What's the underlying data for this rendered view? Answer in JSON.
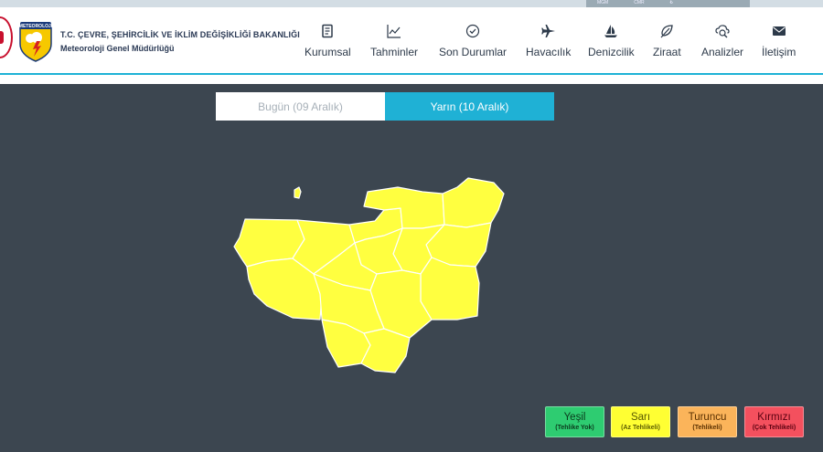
{
  "top_bar": {
    "items": [
      "MGM",
      "CMR",
      "₺"
    ]
  },
  "org": {
    "title": "T.C. ÇEVRE, ŞEHİRCİLİK VE İKLİM DEĞİŞİKLİĞİ BAKANLIĞI",
    "subtitle": "Meteoroloji Genel Müdürlüğü",
    "logo_text": "METEOROLOJİ"
  },
  "nav": [
    {
      "label": "Kurumsal",
      "icon": "document-icon"
    },
    {
      "label": "Tahminler",
      "icon": "chart-icon"
    },
    {
      "label": "Son Durumlar",
      "icon": "check-circle-icon"
    },
    {
      "label": "Havacılık",
      "icon": "plane-icon"
    },
    {
      "label": "Denizcilik",
      "icon": "sailboat-icon"
    },
    {
      "label": "Ziraat",
      "icon": "leaf-icon"
    },
    {
      "label": "Analizler",
      "icon": "analysis-icon"
    },
    {
      "label": "İletişim",
      "icon": "envelope-icon"
    }
  ],
  "tabs": {
    "today": "Bugün (09 Aralık)",
    "tomorrow": "Yarın (10 Aralık)",
    "active": "tomorrow"
  },
  "map": {
    "warning_level": "Sarı",
    "fill_color": "#ffff40",
    "border_color": "#ffffff"
  },
  "legend": [
    {
      "name": "Yeşil",
      "desc": "(Tehlike Yok)",
      "color": "#2ecc71"
    },
    {
      "name": "Sarı",
      "desc": "(Az Tehlikeli)",
      "color": "#ffff33"
    },
    {
      "name": "Turuncu",
      "desc": "(Tehlikeli)",
      "color": "#fbb45a"
    },
    {
      "name": "Kırmızı",
      "desc": "(Çok Tehlikeli)",
      "color": "#f4505e"
    }
  ]
}
